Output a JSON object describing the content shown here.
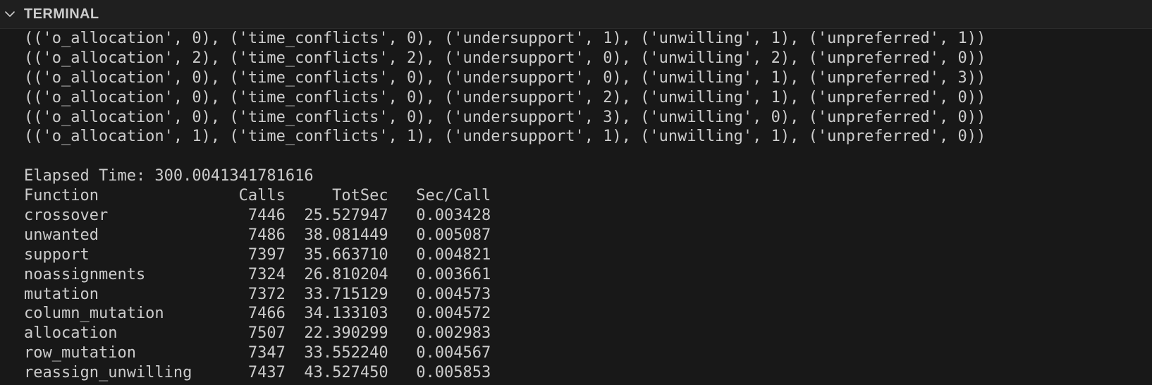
{
  "panel": {
    "title": "TERMINAL",
    "toggle_icon": "chevron-down-icon"
  },
  "terminal": {
    "lines": [
      "(('o_allocation', 0), ('time_conflicts', 0), ('undersupport', 1), ('unwilling', 1), ('unpreferred', 1))",
      "(('o_allocation', 2), ('time_conflicts', 2), ('undersupport', 0), ('unwilling', 2), ('unpreferred', 0))",
      "(('o_allocation', 0), ('time_conflicts', 0), ('undersupport', 0), ('unwilling', 1), ('unpreferred', 3))",
      "(('o_allocation', 0), ('time_conflicts', 0), ('undersupport', 2), ('unwilling', 1), ('unpreferred', 0))",
      "(('o_allocation', 0), ('time_conflicts', 0), ('undersupport', 3), ('unwilling', 0), ('unpreferred', 0))",
      "(('o_allocation', 1), ('time_conflicts', 1), ('undersupport', 1), ('unwilling', 1), ('unpreferred', 0))",
      "",
      "Elapsed Time: 300.0041341781616",
      "Function               Calls     TotSec   Sec/Call",
      "crossover               7446  25.527947   0.003428",
      "unwanted                7486  38.081449   0.005087",
      "support                 7397  35.663710   0.004821",
      "noassignments           7324  26.810204   0.003661",
      "mutation                7372  33.715129   0.004573",
      "column_mutation         7466  34.133103   0.004572",
      "allocation              7507  22.390299   0.002983",
      "row_mutation            7347  33.552240   0.004567",
      "reassign_unwilling      7437  43.527450   0.005853"
    ]
  },
  "colors": {
    "terminal_background": "#181818",
    "header_background": "#1f1f1f",
    "text": "#cccccc"
  }
}
